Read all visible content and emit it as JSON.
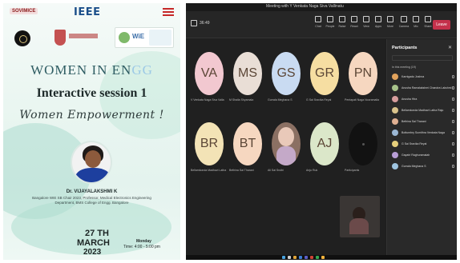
{
  "poster": {
    "logo_left": "SOVIMICE",
    "logo_ieee": "IEEE",
    "logo_box_text": "WiE",
    "title_main": "WOMEN IN EN",
    "title_accent": "GG",
    "subtitle": "Interactive session 1",
    "script_title": "Women Empowerment !",
    "speaker_name": "Dr. VIJAYALAKSHMI K",
    "speaker_info": "Bangalore WIE SB Chair 2023, Professor, Medical Electronics Engineering Department, BMS College of Engg. Bangalore",
    "date_day": "27 TH",
    "date_month": "MARCH",
    "date_year": "2023",
    "date_weekday": "Monday",
    "date_time": "Time: 4:00 - 5:00 pm"
  },
  "teams": {
    "window_title": "Meeting with Y Venkata Naga Siva Vallinatu",
    "timer": "36:49",
    "toolbar": [
      {
        "label": "Chat",
        "icon": "chat-icon"
      },
      {
        "label": "People",
        "icon": "people-icon"
      },
      {
        "label": "Raise",
        "icon": "hand-icon"
      },
      {
        "label": "React",
        "icon": "react-icon"
      },
      {
        "label": "View",
        "icon": "view-icon"
      },
      {
        "label": "Apps",
        "icon": "apps-icon"
      },
      {
        "label": "More",
        "icon": "more-icon"
      },
      {
        "label": "Camera",
        "icon": "camera-icon"
      },
      {
        "label": "Mic",
        "icon": "mic-icon"
      },
      {
        "label": "Share",
        "icon": "share-icon"
      }
    ],
    "leave_label": "Leave",
    "tiles": [
      {
        "initials": "VA",
        "color": "c-pink",
        "name": "V Venkata Naga Siva Valla"
      },
      {
        "initials": "MS",
        "color": "c-grey",
        "name": "M Shaila Shyamala"
      },
      {
        "initials": "GS",
        "color": "c-blue",
        "name": "Gurrala Meghana S"
      },
      {
        "initials": "GR",
        "color": "c-yellow",
        "name": "G Sai Sravika Reyal"
      },
      {
        "initials": "PN",
        "color": "c-peach",
        "name": "Pentapati Naga Nooramalla"
      },
      {
        "initials": "BR",
        "color": "c-sand",
        "name": "Bellamkonda Madhavi Latha"
      },
      {
        "initials": "BT",
        "color": "c-peach",
        "name": "Bethina Sai Tharani"
      },
      {
        "initials": "",
        "color": "c-photo",
        "name": "Ali Sai Sruthi"
      },
      {
        "initials": "AJ",
        "color": "c-mint",
        "name": "Anju Ruk"
      },
      {
        "initials": "",
        "color": "c-dark",
        "name": "Participants"
      }
    ],
    "panel_title": "Participants",
    "panel_section": "In this meeting (19)",
    "participants": [
      {
        "name": "Karnigadu Joshna",
        "color": "#e2a35c"
      },
      {
        "name": "Anusha Ramalakshmi Chandra Lakshmi",
        "color": "#a7c28a"
      },
      {
        "name": "Anusha Hira",
        "color": "#d69d9d"
      },
      {
        "name": "Bellamkonda Madhavi Latha Raju",
        "color": "#d9c38c"
      },
      {
        "name": "Bethina Sai Tharani",
        "color": "#e0b092"
      },
      {
        "name": "Bottumbry Sumithra Venkata Naga",
        "color": "#9bb7d4"
      },
      {
        "name": "G Sai Sravika Reyal",
        "color": "#e6cf7c"
      },
      {
        "name": "Gayatri Raghuramaiah",
        "color": "#b89ed6"
      },
      {
        "name": "Gurrala Meghana S",
        "color": "#9ec4e0"
      }
    ]
  }
}
